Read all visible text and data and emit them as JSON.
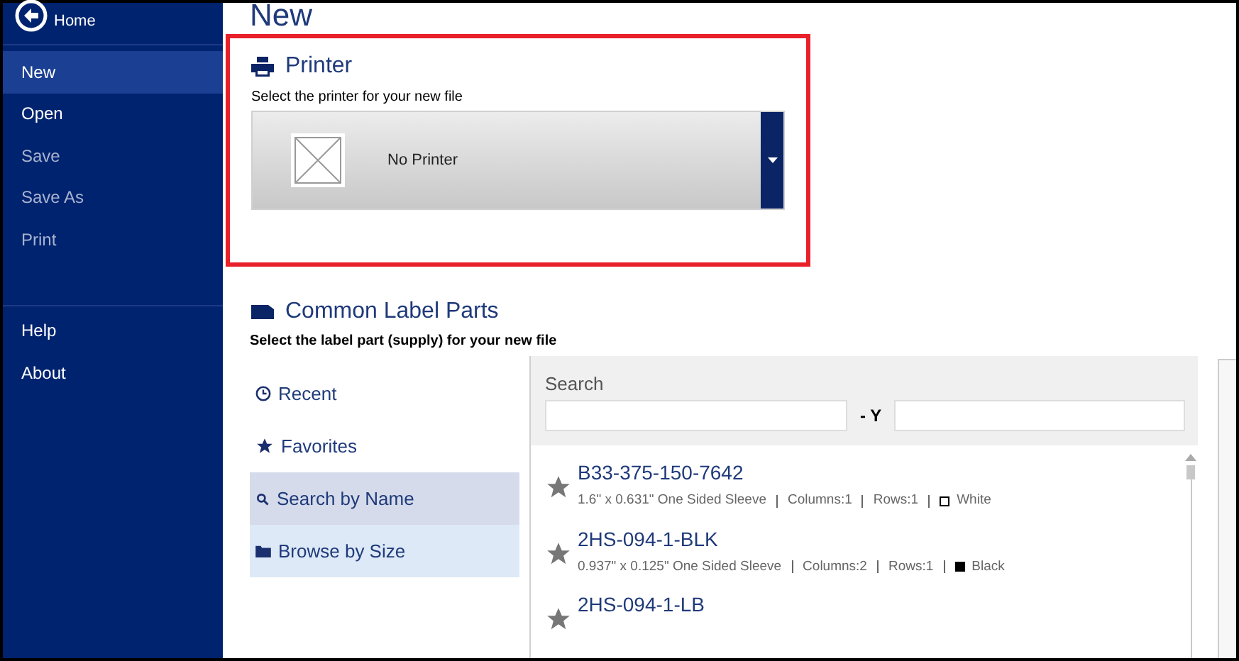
{
  "sidebar": {
    "home_label": "Home",
    "items": [
      {
        "label": "New",
        "selected": true,
        "disabled": false
      },
      {
        "label": "Open",
        "selected": false,
        "disabled": false
      },
      {
        "label": "Save",
        "selected": false,
        "disabled": true
      },
      {
        "label": "Save As",
        "selected": false,
        "disabled": true
      },
      {
        "label": "Print",
        "selected": false,
        "disabled": true
      }
    ],
    "footer_items": [
      {
        "label": "Help",
        "selected": false
      },
      {
        "label": "About",
        "selected": false
      }
    ]
  },
  "page_title": "New",
  "printer": {
    "title": "Printer",
    "hint": "Select the printer for your new file",
    "selected_printer": "No Printer"
  },
  "label_parts": {
    "title": "Common Label Parts",
    "hint": "Select the label part (supply) for your new file",
    "nav": [
      {
        "kind": "recent",
        "label": "Recent",
        "selected": false
      },
      {
        "kind": "favorites",
        "label": "Favorites",
        "selected": false
      },
      {
        "kind": "search",
        "label": "Search by Name",
        "selected": true
      },
      {
        "kind": "browse",
        "label": "Browse by Size",
        "selected": false
      }
    ],
    "search_label": "Search",
    "range_separator": "- Y",
    "parts": [
      {
        "name": "B33-375-150-7642",
        "size": "1.6\" x 0.631\" One Sided Sleeve",
        "columns": "Columns:1",
        "rows": "Rows:1",
        "color_name": "White",
        "color": "#ffffff"
      },
      {
        "name": "2HS-094-1-BLK",
        "size": "0.937\" x 0.125\" One Sided Sleeve",
        "columns": "Columns:2",
        "rows": "Rows:1",
        "color_name": "Black",
        "color": "#000000"
      },
      {
        "name": "2HS-094-1-LB"
      }
    ]
  }
}
